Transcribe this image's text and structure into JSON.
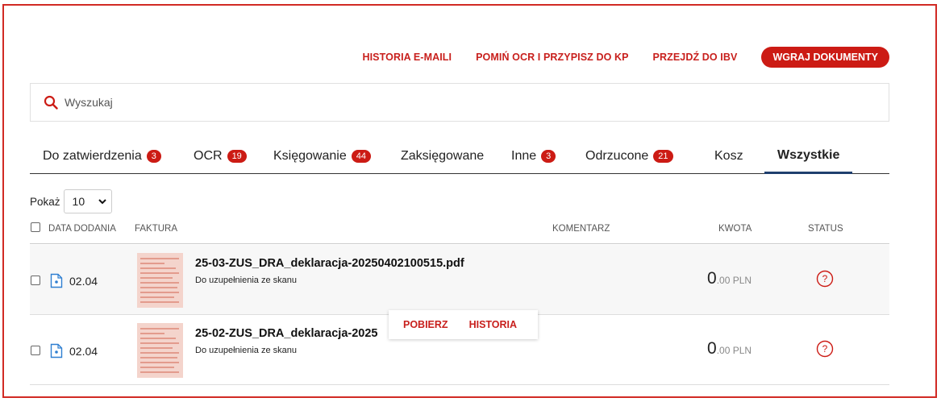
{
  "actions": {
    "email_history": "HISTORIA E-MAILI",
    "skip_ocr": "POMIŃ OCR I PRZYPISZ DO KP",
    "go_ibv": "PRZEJDŹ DO IBV",
    "upload": "WGRAJ DOKUMENTY"
  },
  "search": {
    "placeholder": "Wyszukaj",
    "icon": "search-icon"
  },
  "tabs": [
    {
      "label": "Do zatwierdzenia",
      "count": "3"
    },
    {
      "label": "OCR",
      "count": "19"
    },
    {
      "label": "Księgowanie",
      "count": "44"
    },
    {
      "label": "Zaksięgowane"
    },
    {
      "label": "Inne",
      "count": "3"
    },
    {
      "label": "Odrzucone",
      "count": "21"
    },
    {
      "label": "Kosz"
    },
    {
      "label": "Wszystkie",
      "active": true
    }
  ],
  "page_size": {
    "label": "Pokaż",
    "value": "10"
  },
  "table": {
    "headers": {
      "date": "DATA DODANIA",
      "invoice": "FAKTURA",
      "comment": "KOMENTARZ",
      "amount": "KWOTA",
      "status": "STATUS"
    },
    "rows": [
      {
        "date": "02.04",
        "title": "25-03-ZUS_DRA_deklaracja-20250402100515.pdf",
        "subtitle": "Do uzupełnienia ze skanu",
        "amount_int": "0",
        "amount_dec": ".00 PLN",
        "status": "?"
      },
      {
        "date": "02.04",
        "title": "25-02-ZUS_DRA_deklaracja-2025",
        "subtitle": "Do uzupełnienia ze skanu",
        "amount_int": "0",
        "amount_dec": ".00 PLN",
        "status": "?"
      }
    ]
  },
  "context_menu": {
    "download": "POBIERZ",
    "history": "HISTORIA"
  },
  "colors": {
    "accent": "#cc1b14",
    "tab_underline": "#1f3f6e"
  }
}
